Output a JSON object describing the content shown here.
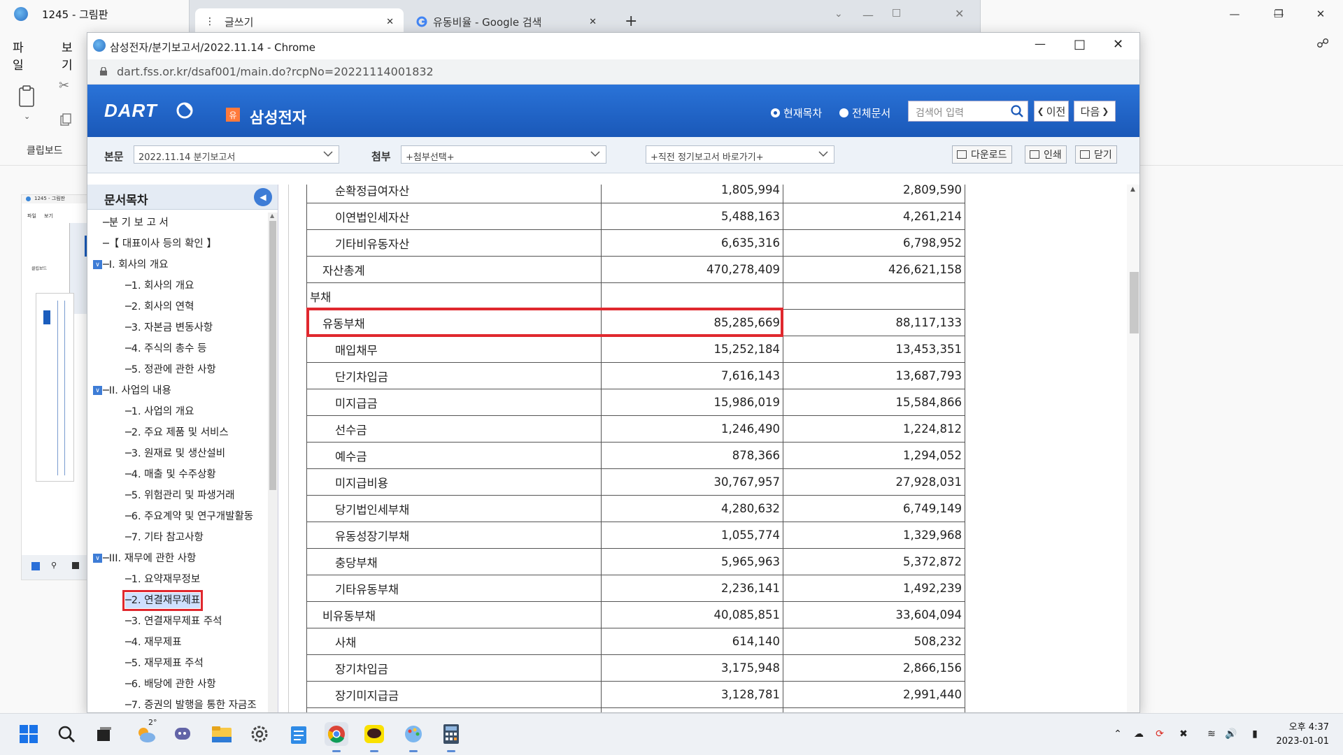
{
  "paint": {
    "title": "1245 - 그림판",
    "menu": [
      "파일",
      "보기"
    ],
    "clipboard_label": "클립보드"
  },
  "tabs": [
    {
      "label": "글쓰기"
    },
    {
      "label": "유동비율 - Google 검색"
    }
  ],
  "chrome": {
    "title": "삼성전자/분기보고서/2022.11.14 - Chrome",
    "url": "dart.fss.or.kr/dsaf001/main.do?rcpNo=20221114001832"
  },
  "dart": {
    "logo": "DART",
    "company_badge": "유",
    "company_name": "삼성전자",
    "radio_current": "현재목차",
    "radio_all": "전체문서",
    "search_placeholder": "검색어 입력",
    "prev_label": "이전",
    "next_label": "다음"
  },
  "toolbar": {
    "body_label": "본문",
    "body_select": "2022.11.14  분기보고서",
    "attach_label": "첨부",
    "attach_select": "+첨부선택+",
    "report_select": "+직전 정기보고서 바로가기+",
    "download_label": "다운로드",
    "print_label": "인쇄",
    "close_label": "닫기"
  },
  "toc": {
    "title": "문서목차",
    "items": [
      {
        "label": "분 기 보 고 서",
        "level": 0
      },
      {
        "label": "【 대표이사 등의 확인 】",
        "level": 0
      },
      {
        "label": "I. 회사의 개요",
        "level": 0,
        "expandable": true
      },
      {
        "label": "1. 회사의 개요",
        "level": 1
      },
      {
        "label": "2. 회사의 연혁",
        "level": 1
      },
      {
        "label": "3. 자본금 변동사항",
        "level": 1
      },
      {
        "label": "4. 주식의 총수 등",
        "level": 1
      },
      {
        "label": "5. 정관에 관한 사항",
        "level": 1
      },
      {
        "label": "II. 사업의 내용",
        "level": 0,
        "expandable": true
      },
      {
        "label": "1. 사업의 개요",
        "level": 1
      },
      {
        "label": "2. 주요 제품 및 서비스",
        "level": 1
      },
      {
        "label": "3. 원재료 및 생산설비",
        "level": 1
      },
      {
        "label": "4. 매출 및 수주상황",
        "level": 1
      },
      {
        "label": "5. 위험관리 및 파생거래",
        "level": 1
      },
      {
        "label": "6. 주요계약 및 연구개발활동",
        "level": 1
      },
      {
        "label": "7. 기타 참고사항",
        "level": 1
      },
      {
        "label": "III. 재무에 관한 사항",
        "level": 0,
        "expandable": true
      },
      {
        "label": "1. 요약재무정보",
        "level": 1
      },
      {
        "label": "2. 연결재무제표",
        "level": 1,
        "selected": true
      },
      {
        "label": "3. 연결재무제표 주석",
        "level": 1
      },
      {
        "label": "4. 재무제표",
        "level": 1
      },
      {
        "label": "5. 재무제표 주석",
        "level": 1
      },
      {
        "label": "6. 배당에 관한 사항",
        "level": 1
      },
      {
        "label": "7. 증권의 발행을 통한 자금조",
        "level": 1
      }
    ]
  },
  "table": {
    "rows": [
      {
        "label": "순확정급여자산",
        "v1": "1,805,994",
        "v2": "2,809,590",
        "level": 3
      },
      {
        "label": "이연법인세자산",
        "v1": "5,488,163",
        "v2": "4,261,214",
        "level": 3
      },
      {
        "label": "기타비유동자산",
        "v1": "6,635,316",
        "v2": "6,798,952",
        "level": 3
      },
      {
        "label": "자산총계",
        "v1": "470,278,409",
        "v2": "426,621,158",
        "level": 2
      },
      {
        "label": "부채",
        "v1": "",
        "v2": "",
        "level": 1
      },
      {
        "label": "유동부채",
        "v1": "85,285,669",
        "v2": "88,117,133",
        "level": 2
      },
      {
        "label": "매입채무",
        "v1": "15,252,184",
        "v2": "13,453,351",
        "level": 3
      },
      {
        "label": "단기차입금",
        "v1": "7,616,143",
        "v2": "13,687,793",
        "level": 3
      },
      {
        "label": "미지급금",
        "v1": "15,986,019",
        "v2": "15,584,866",
        "level": 3
      },
      {
        "label": "선수금",
        "v1": "1,246,490",
        "v2": "1,224,812",
        "level": 3
      },
      {
        "label": "예수금",
        "v1": "878,366",
        "v2": "1,294,052",
        "level": 3
      },
      {
        "label": "미지급비용",
        "v1": "30,767,957",
        "v2": "27,928,031",
        "level": 3
      },
      {
        "label": "당기법인세부채",
        "v1": "4,280,632",
        "v2": "6,749,149",
        "level": 3
      },
      {
        "label": "유동성장기부채",
        "v1": "1,055,774",
        "v2": "1,329,968",
        "level": 3
      },
      {
        "label": "충당부채",
        "v1": "5,965,963",
        "v2": "5,372,872",
        "level": 3
      },
      {
        "label": "기타유동부채",
        "v1": "2,236,141",
        "v2": "1,492,239",
        "level": 3
      },
      {
        "label": "비유동부채",
        "v1": "40,085,851",
        "v2": "33,604,094",
        "level": 2
      },
      {
        "label": "사채",
        "v1": "614,140",
        "v2": "508,232",
        "level": 3
      },
      {
        "label": "장기차입금",
        "v1": "3,175,948",
        "v2": "2,866,156",
        "level": 3
      },
      {
        "label": "장기미지급금",
        "v1": "3,128,781",
        "v2": "2,991,440",
        "level": 3
      },
      {
        "label": "",
        "v1": "",
        "v2": "",
        "level": 3
      }
    ]
  },
  "taskbar": {
    "weather_temp": "2°",
    "clock_time": "오후 4:37",
    "clock_date": "2023-01-01"
  }
}
